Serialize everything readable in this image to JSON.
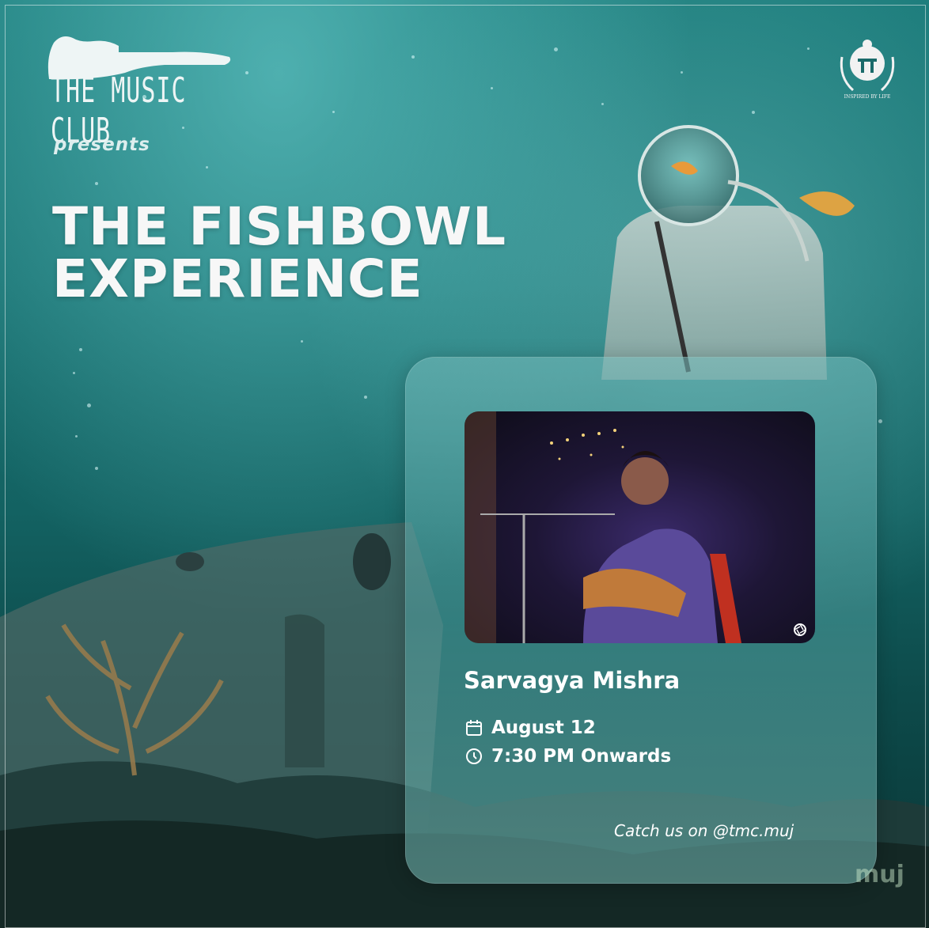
{
  "brand": {
    "logo_text": "THE MUSIC CLUB",
    "emblem_motto": "INSPIRED BY LIFE"
  },
  "event": {
    "presents": "presents",
    "title_line1": "THE FISHBOWL",
    "title_line2": "EXPERIENCE"
  },
  "card": {
    "artist": "Sarvagya Mishra",
    "date": "August 12",
    "time": "7:30 PM Onwards",
    "social": "Catch us on @tmc.muj"
  },
  "watermark": "muj",
  "icons": {
    "date": "calendar-icon",
    "time": "clock-icon",
    "photo_corner": "aperture-icon"
  },
  "colors": {
    "water_top": "#1c7c7b",
    "water_bottom": "#0a3535",
    "text": "#ffffff"
  }
}
